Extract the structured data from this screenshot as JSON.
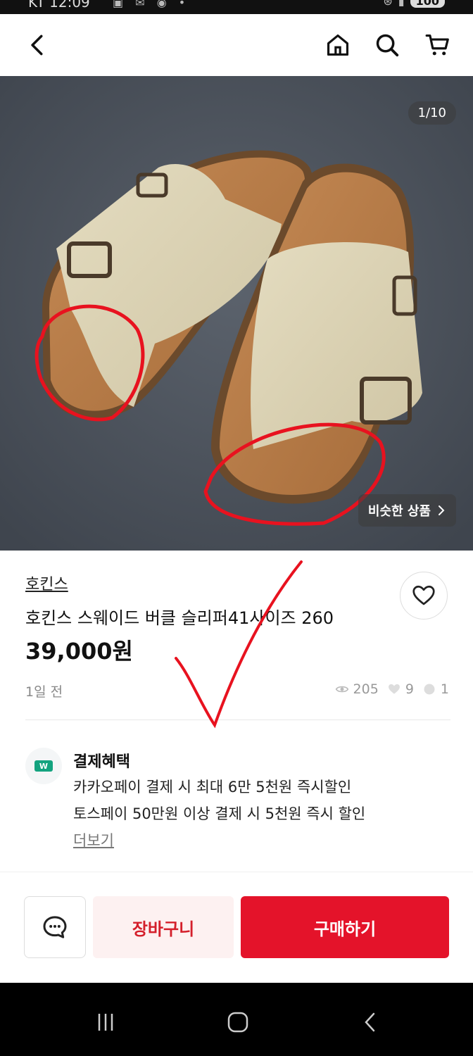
{
  "status_bar": {
    "time": "KT 12:09",
    "battery": "100"
  },
  "nav": {
    "back_icon": "chevron-left-icon",
    "home_icon": "home-icon",
    "search_icon": "search-icon",
    "cart_icon": "cart-icon"
  },
  "gallery": {
    "counter": "1/10",
    "similar_label": "비슷한 상품"
  },
  "product": {
    "store": "호킨스",
    "title": "호킨스 스웨이드 버클 슬리퍼41사이즈 260",
    "price": "39,000원",
    "posted": "1일 전",
    "views": "205",
    "likes": "9",
    "chats": "1"
  },
  "benefits": {
    "title": "결제혜택",
    "icon_label": "W",
    "lines": [
      "카카오페이 결제 시 최대 6만 5천원 즉시할인",
      "토스페이 50만원 이상 결제 시 5천원 즉시 할인"
    ],
    "more": "더보기"
  },
  "actions": {
    "cart": "장바구니",
    "buy": "구매하기"
  },
  "colors": {
    "accent": "#e4132a",
    "cart_bg": "#fdf1f1",
    "annotation_red": "#e8121f"
  }
}
